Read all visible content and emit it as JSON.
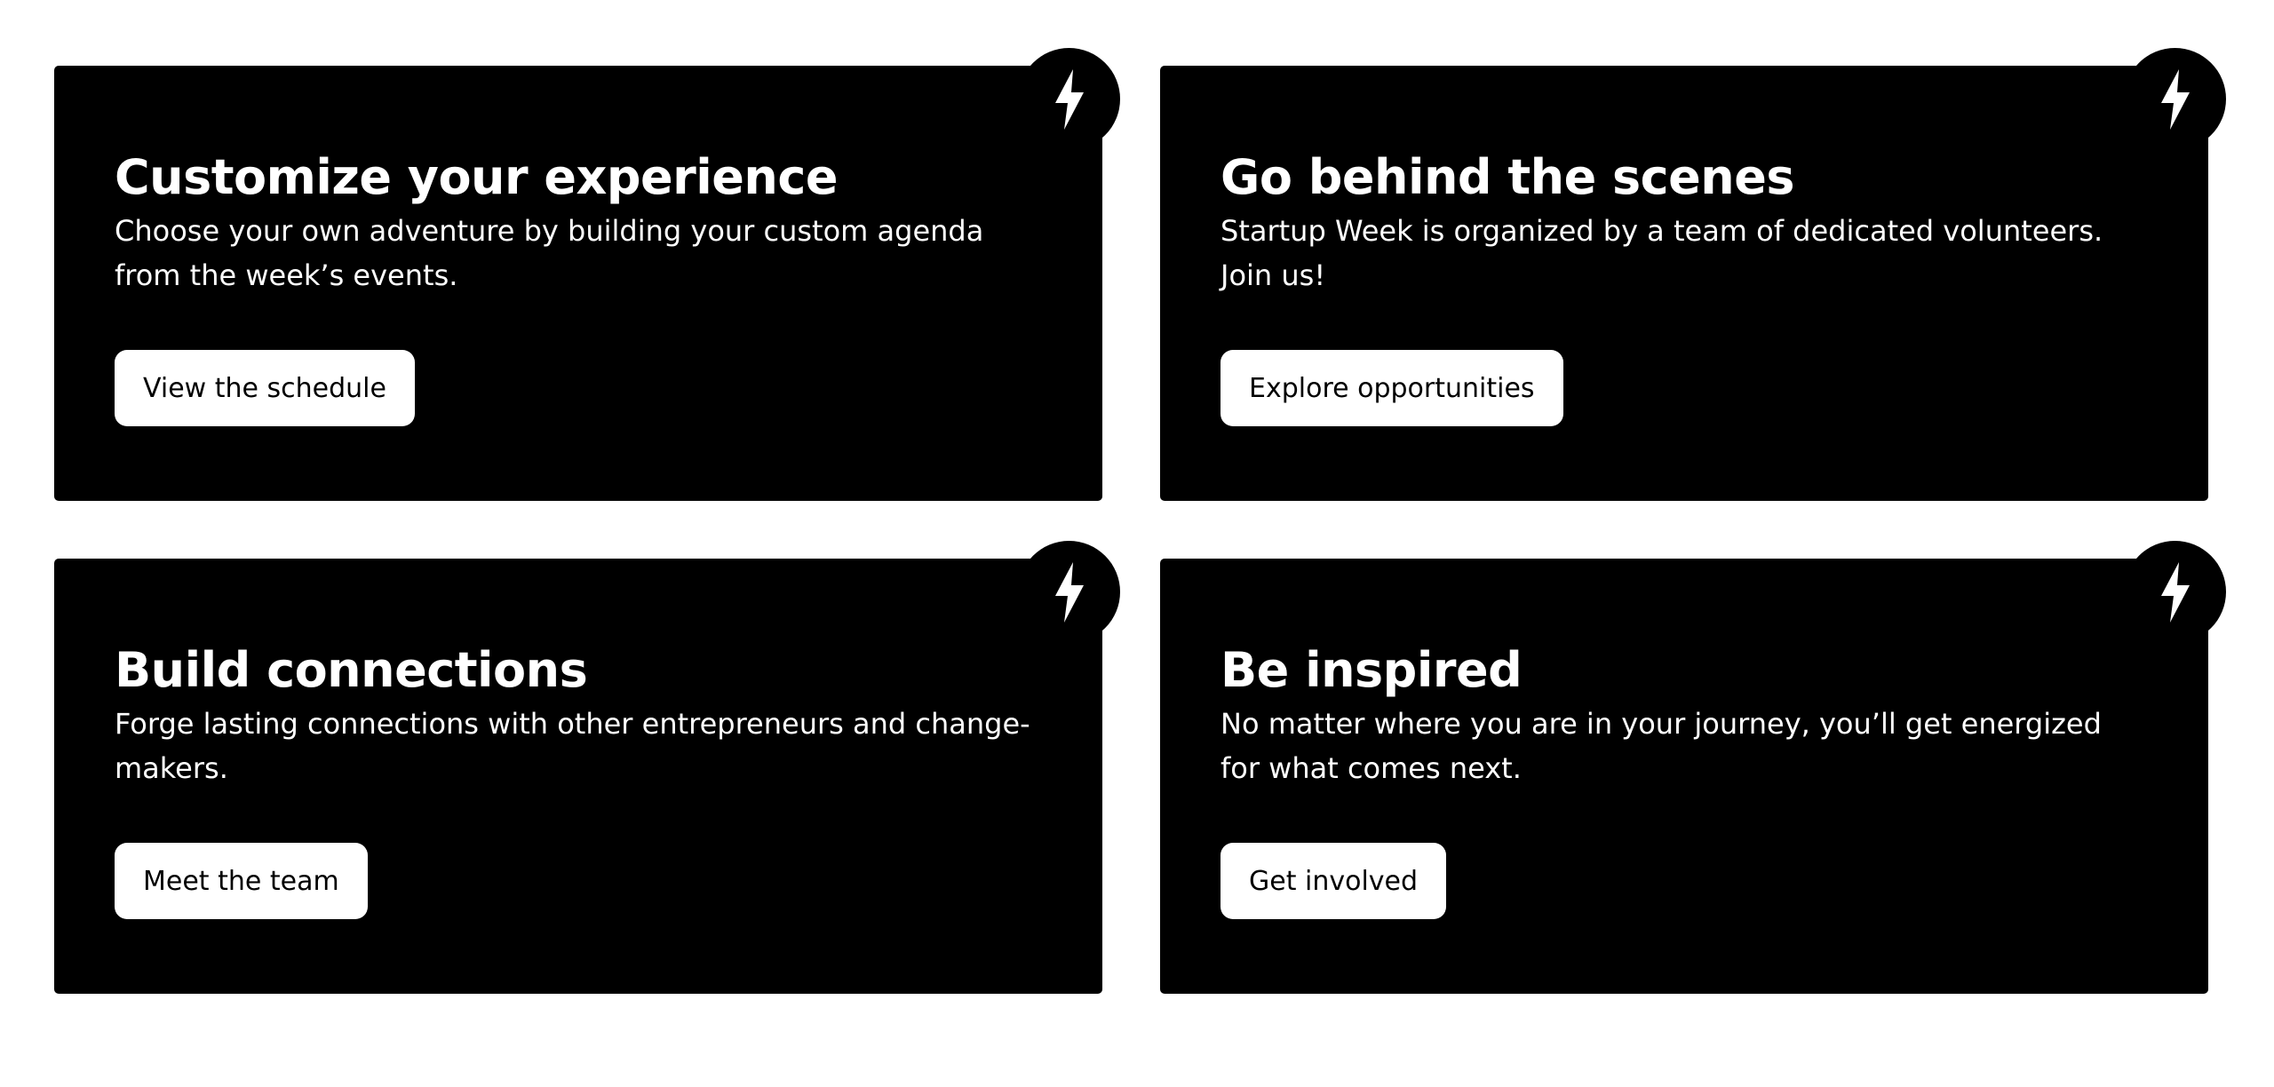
{
  "cards": [
    {
      "title": "Customize your experience",
      "description": "Choose your own adventure by building your custom agenda from the week’s events.",
      "button_label": "View the schedule",
      "icon": "lightning-bolt-icon"
    },
    {
      "title": "Go behind the scenes",
      "description": "Startup Week is organized by a team of dedicated volunteers. Join us!",
      "button_label": "Explore opportunities",
      "icon": "lightning-bolt-icon"
    },
    {
      "title": "Build connections",
      "description": "Forge lasting connections with other entrepreneurs and change-makers.",
      "button_label": "Meet the team",
      "icon": "lightning-bolt-icon"
    },
    {
      "title": "Be inspired",
      "description": "No matter where you are in your journey, you’ll get energized for what comes next.",
      "button_label": "Get involved",
      "icon": "lightning-bolt-icon"
    }
  ],
  "colors": {
    "card_background": "#000000",
    "card_text": "#ffffff",
    "button_background": "#ffffff",
    "button_text": "#000000",
    "page_background": "#ffffff"
  }
}
